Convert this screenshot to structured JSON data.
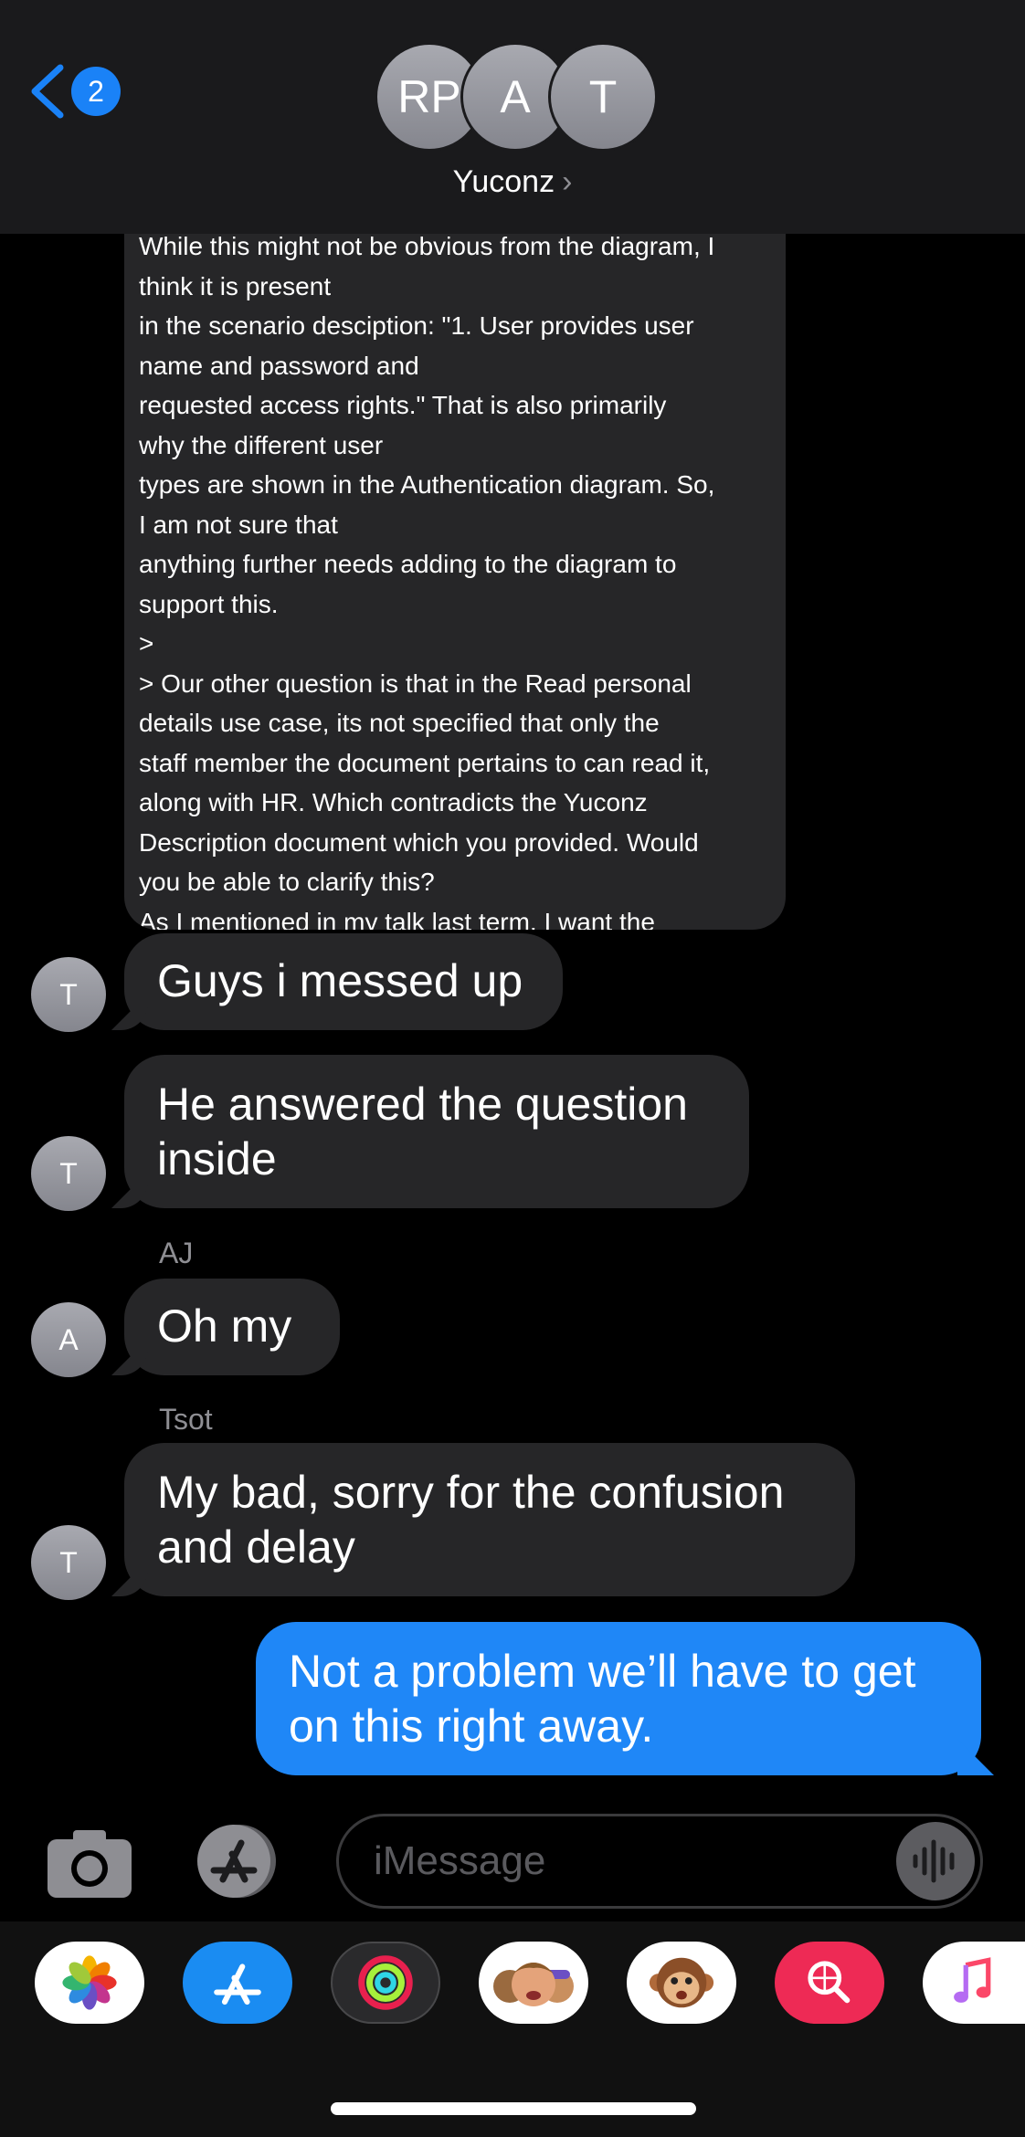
{
  "header": {
    "back_count": "2",
    "avatars": [
      "RP",
      "A",
      "T"
    ],
    "group_name": "Yuconz",
    "chevron": "›"
  },
  "long_message": {
    "lines": [
      "While this might not be obvious from the diagram, I",
      "think it is present",
      "in the scenario desciption: \"1. User provides user",
      "name and password and",
      "requested access rights.\" That is also primarily",
      "why the different user",
      "types are shown in the Authentication diagram. So,",
      "I am not sure that",
      "anything further needs adding to the diagram to",
      "support this.",
      ">",
      "> Our other question is that in the Read personal",
      "details use case, its not specified that only the",
      "staff member the document pertains to can read it,",
      "along with HR. Which contradicts the Yuconz",
      "Description document which you provided. Would",
      "you be able to clarify this?",
      "As I mentioned in my talk last term, I want the"
    ]
  },
  "messages": [
    {
      "avatar": "T",
      "text": "Guys i messed up"
    },
    {
      "avatar": "T",
      "text": "He answered the question inside"
    },
    {
      "sender": "AJ",
      "avatar": "A",
      "text": "Oh my"
    },
    {
      "sender": "Tsot",
      "avatar": "T",
      "text": "My bad, sorry for the confusion and delay"
    },
    {
      "text": "Not a problem we’ll have to get on this right away."
    }
  ],
  "input": {
    "placeholder": "iMessage"
  },
  "apps": [
    "photos-icon",
    "app-store-icon",
    "activity-icon",
    "memoji-icon",
    "animoji-monkey-icon",
    "images-search-icon",
    "music-icon"
  ],
  "colors": {
    "accent": "#1f87f7",
    "bubble": "#262628",
    "background": "#000000"
  }
}
